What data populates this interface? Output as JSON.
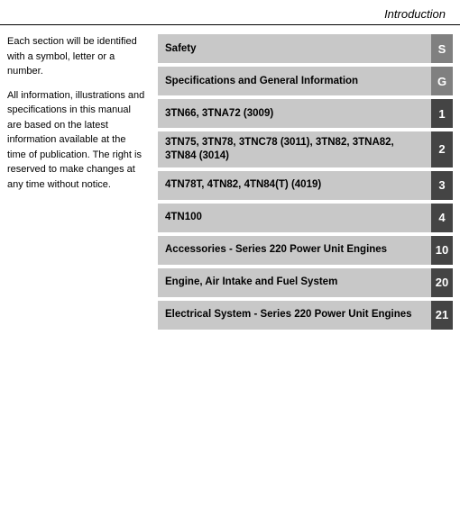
{
  "header": {
    "title": "Introduction"
  },
  "left_text": {
    "paragraph1": "Each section will be identified with a symbol, letter or a number.",
    "paragraph2": "All information, illustrations and specifications in this manual are based on the latest information available at the time of publication. The right is reserved to make changes at any time without notice."
  },
  "menu_items": [
    {
      "label": "Safety",
      "badge": "S",
      "dark": false
    },
    {
      "label": "Specifications and General Information",
      "badge": "G",
      "dark": false
    },
    {
      "label": "3TN66, 3TNA72 (3009)",
      "badge": "1",
      "dark": true
    },
    {
      "label": "3TN75, 3TN78, 3TNC78 (3011), 3TN82, 3TNA82, 3TN84 (3014)",
      "badge": "2",
      "dark": true
    },
    {
      "label": "4TN78T, 4TN82, 4TN84(T) (4019)",
      "badge": "3",
      "dark": true
    },
    {
      "label": "4TN100",
      "badge": "4",
      "dark": true
    },
    {
      "label": "Accessories - Series 220 Power Unit Engines",
      "badge": "10",
      "dark": true
    },
    {
      "label": "Engine, Air Intake and Fuel System",
      "badge": "20",
      "dark": true
    },
    {
      "label": "Electrical System - Series 220 Power Unit Engines",
      "badge": "21",
      "dark": true
    }
  ]
}
